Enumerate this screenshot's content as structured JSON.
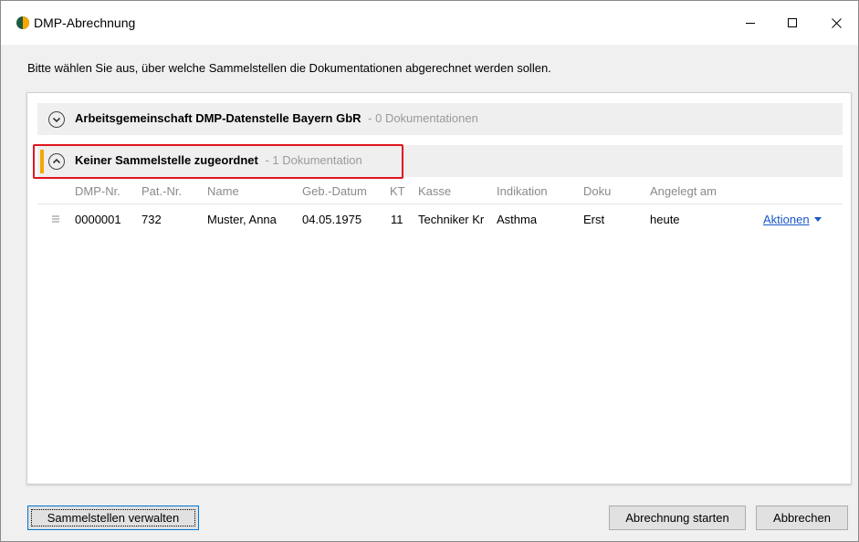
{
  "window": {
    "title": "DMP-Abrechnung",
    "icon": "app-logo-icon",
    "controls": {
      "minimize": "minimize-icon",
      "maximize": "maximize-icon",
      "close": "close-icon"
    }
  },
  "instruction": "Bitte wählen Sie aus, über welche Sammelstellen die Dokumentationen abgerechnet werden sollen.",
  "groups": [
    {
      "title": "Arbeitsgemeinschaft DMP-Datenstelle Bayern GbR",
      "count": "- 0 Dokumentationen",
      "state": "collapsed"
    },
    {
      "title": "Keiner Sammelstelle zugeordnet",
      "count": "- 1 Dokumentation",
      "state": "expanded"
    }
  ],
  "table": {
    "columns": [
      "DMP-Nr.",
      "Pat.-Nr.",
      "Name",
      "Geb.-Datum",
      "KT",
      "Kasse",
      "Indikation",
      "Doku",
      "Angelegt am"
    ],
    "rows": [
      {
        "dmp_nr": "0000001",
        "pat_nr": "732",
        "name": "Muster, Anna",
        "geb_datum": "04.05.1975",
        "kt": "11",
        "kasse": "Techniker Kr",
        "indikation": "Asthma",
        "doku": "Erst",
        "angelegt_am": "heute",
        "action_label": "Aktionen"
      }
    ]
  },
  "buttons": {
    "manage": "Sammelstellen verwalten",
    "start": "Abrechnung starten",
    "cancel": "Abbrechen"
  },
  "colors": {
    "accent": "#f5a800",
    "highlight": "#e0151f",
    "link": "#1a56c8"
  }
}
